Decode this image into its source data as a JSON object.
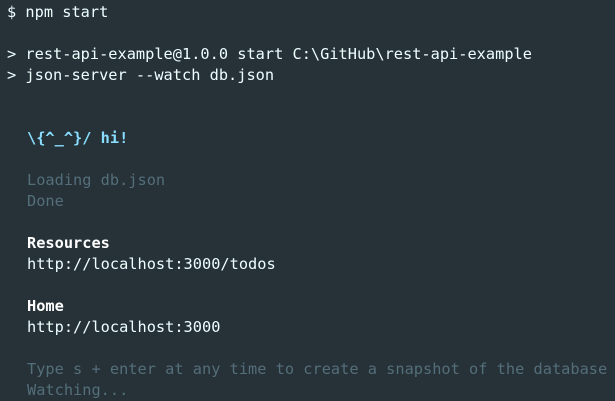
{
  "terminal": {
    "prompt_line": "$ npm start",
    "script_line_1": "> rest-api-example@1.0.0 start C:\\GitHub\\rest-api-example",
    "script_line_2": "> json-server --watch db.json",
    "greeting": "\\{^_^}/ hi!",
    "loading": "Loading db.json",
    "done": "Done",
    "resources_heading": "Resources",
    "resources_url": "http://localhost:3000/todos",
    "home_heading": "Home",
    "home_url": "http://localhost:3000",
    "snapshot_hint": "Type s + enter at any time to create a snapshot of the database",
    "watching": "Watching..."
  },
  "colors": {
    "background": "#263238",
    "text": "#eeffff",
    "muted": "#546e7a",
    "accent": "#89ddff"
  }
}
